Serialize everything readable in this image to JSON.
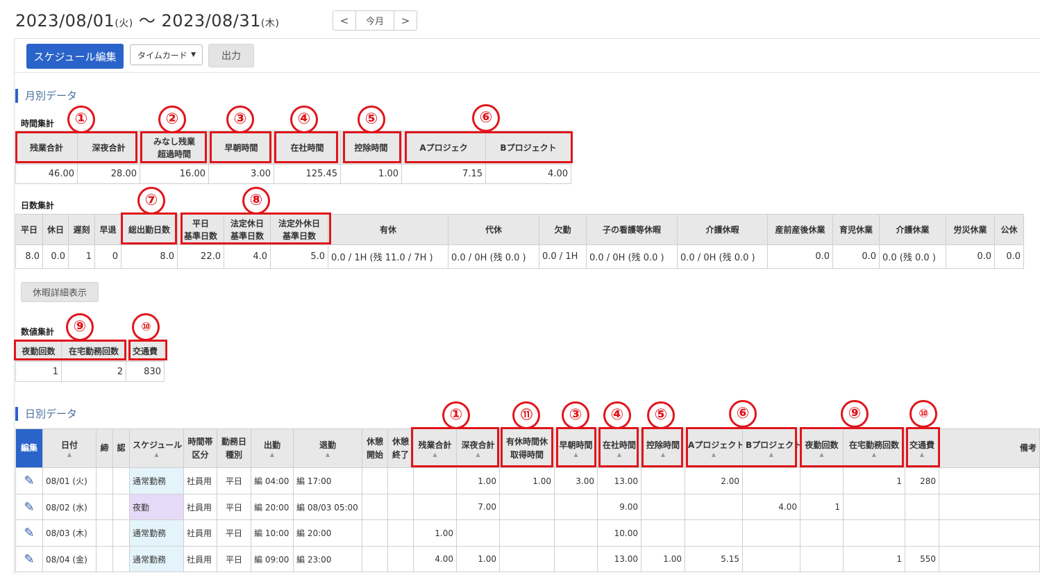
{
  "header": {
    "start_date": "2023/08/01",
    "start_dow": "(火)",
    "tilde": " 〜 ",
    "end_date": "2023/08/31",
    "end_dow": "(木)",
    "prev": "<",
    "today": "今月",
    "next": ">"
  },
  "toolbar": {
    "edit_schedule": "スケジュール編集",
    "timecard_select": "タイムカード",
    "output": "出力"
  },
  "monthly": {
    "section_title": "月別データ",
    "time_title": "時間集計",
    "time_headers": [
      "残業合計",
      "深夜合計",
      "みなし残業",
      "超過時間",
      "早朝時間",
      "在社時間",
      "控除時間",
      "Aプロジェク",
      "Bプロジェクト"
    ],
    "time_values": [
      "46.00",
      "28.00",
      "16.00",
      "3.00",
      "125.45",
      "1.00",
      "7.15",
      "4.00"
    ],
    "days_title": "日数集計",
    "days_headers": [
      "平日",
      "休日",
      "遅刻",
      "早退",
      "総出勤日数",
      "平日",
      "基準日数",
      "法定休日",
      "基準日数",
      "法定外休日",
      "基準日数",
      "有休",
      "代休",
      "欠勤",
      "子の看護等休暇",
      "介護休暇",
      "産前産後休業",
      "育児休業",
      "介護休業",
      "労災休業",
      "公休"
    ],
    "days_values": [
      "8.0",
      "0.0",
      "1",
      "0",
      "8.0",
      "22.0",
      "4.0",
      "5.0",
      "0.0 / 1H (残 11.0 / 7H )",
      "0.0 / 0H (残 0.0 )",
      "0.0 / 1H",
      "0.0 / 0H (残 0.0 )",
      "0.0 / 0H (残 0.0 )",
      "0.0",
      "0.0",
      "0.0 (残 0.0 )",
      "0.0",
      "0.0"
    ],
    "leave_detail_button": "休暇詳細表示",
    "count_title": "数値集計",
    "count_headers": [
      "夜勤回数",
      "在宅勤務回数",
      "交通費"
    ],
    "count_values": [
      "1",
      "2",
      "830"
    ]
  },
  "daily": {
    "section_title": "日別データ",
    "headers": {
      "edit": "編集",
      "date": "日付",
      "lock": "締",
      "approve": "認",
      "schedule": "スケジュール",
      "timezone_1": "時間帯",
      "timezone_2": "区分",
      "daytype_1": "勤務日",
      "daytype_2": "種別",
      "clock_in": "出勤",
      "clock_out": "退勤",
      "break_start_1": "休憩",
      "break_start_2": "開始",
      "break_end_1": "休憩",
      "break_end_2": "終了",
      "overtime": "残業合計",
      "night": "深夜合計",
      "paid_hourly_1": "有休時間休",
      "paid_hourly_2": "取得時間",
      "early": "早朝時間",
      "office": "在社時間",
      "deduct": "控除時間",
      "proj_a": "Aプロジェクト",
      "proj_b": "Bプロジェクト",
      "night_count": "夜勤回数",
      "remote_count": "在宅勤務回数",
      "transport": "交通費",
      "remarks": "備考"
    },
    "rows": [
      {
        "date": "08/01 (火)",
        "schedule": "通常勤務",
        "zone": "社員用",
        "daytype": "平日",
        "in": "編 04:00",
        "out": "編 17:00",
        "overtime": "",
        "night": "1.00",
        "paid": "1.00",
        "early": "3.00",
        "office": "13.00",
        "deduct": "",
        "proj_a": "2.00",
        "proj_b": "",
        "night_count": "",
        "remote": "1",
        "transport": "280"
      },
      {
        "date": "08/02 (水)",
        "schedule": "夜勤",
        "zone": "社員用",
        "daytype": "平日",
        "in": "編 20:00",
        "out": "編 08/03 05:00",
        "overtime": "",
        "night": "7.00",
        "paid": "",
        "early": "",
        "office": "9.00",
        "deduct": "",
        "proj_a": "",
        "proj_b": "4.00",
        "night_count": "1",
        "remote": "",
        "transport": ""
      },
      {
        "date": "08/03 (木)",
        "schedule": "通常勤務",
        "zone": "社員用",
        "daytype": "平日",
        "in": "編 10:00",
        "out": "編 20:00",
        "overtime": "1.00",
        "night": "",
        "paid": "",
        "early": "",
        "office": "10.00",
        "deduct": "",
        "proj_a": "",
        "proj_b": "",
        "night_count": "",
        "remote": "",
        "transport": ""
      },
      {
        "date": "08/04 (金)",
        "schedule": "通常勤務",
        "zone": "社員用",
        "daytype": "平日",
        "in": "編 09:00",
        "out": "編 23:00",
        "overtime": "4.00",
        "night": "1.00",
        "paid": "",
        "early": "",
        "office": "13.00",
        "deduct": "1.00",
        "proj_a": "5.15",
        "proj_b": "",
        "night_count": "",
        "remote": "1",
        "transport": "550"
      }
    ]
  },
  "annotations": [
    "①",
    "②",
    "③",
    "④",
    "⑤",
    "⑥",
    "⑦",
    "⑧",
    "⑨",
    "⑩",
    "⑪"
  ],
  "colors": {
    "accent": "#2a63c9",
    "annotation": "#e0151b",
    "schedule_normal": "#e4f4fb",
    "schedule_night": "#e7d9f8"
  },
  "icons": {
    "edit": "pencil-icon",
    "prev": "chevron-left-icon",
    "next": "chevron-right-icon",
    "dropdown": "caret-down-icon"
  }
}
